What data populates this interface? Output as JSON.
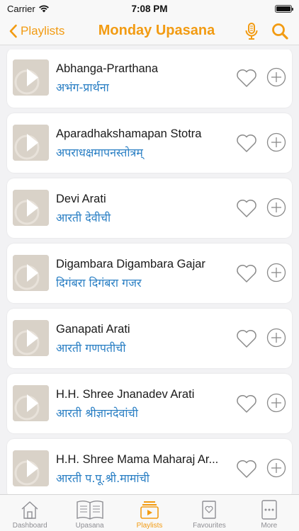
{
  "status_bar": {
    "carrier": "Carrier",
    "time": "7:08 PM"
  },
  "nav": {
    "back_label": "Playlists",
    "title": "Monday Upasana",
    "accent_color": "#f29b12"
  },
  "tracks": [
    {
      "title": "Abhanga-Prarthana",
      "subtitle": "अभंग-प्रार्थना"
    },
    {
      "title": "Aparadhakshamapan Stotra",
      "subtitle": "अपराधक्षमापनस्तोत्रम्"
    },
    {
      "title": "Devi Arati",
      "subtitle": "आरती देवीची"
    },
    {
      "title": "Digambara Digambara Gajar",
      "subtitle": "दिगंबरा दिगंबरा गजर"
    },
    {
      "title": "Ganapati Arati",
      "subtitle": "आरती गणपतीची"
    },
    {
      "title": "H.H. Shree Jnanadev Arati",
      "subtitle": "आरती श्रीज्ञानदेवांची"
    },
    {
      "title": "H.H. Shree Mama Maharaj Ar...",
      "subtitle": "आरती प.पू.श्री.मामांची"
    }
  ],
  "tab_bar": {
    "tabs": [
      {
        "label": "Dashboard",
        "icon": "home-icon"
      },
      {
        "label": "Upasana",
        "icon": "book-icon"
      },
      {
        "label": "Playlists",
        "icon": "playlist-icon"
      },
      {
        "label": "Favourites",
        "icon": "favourites-icon"
      },
      {
        "label": "More",
        "icon": "more-icon"
      }
    ],
    "active": "Playlists"
  }
}
